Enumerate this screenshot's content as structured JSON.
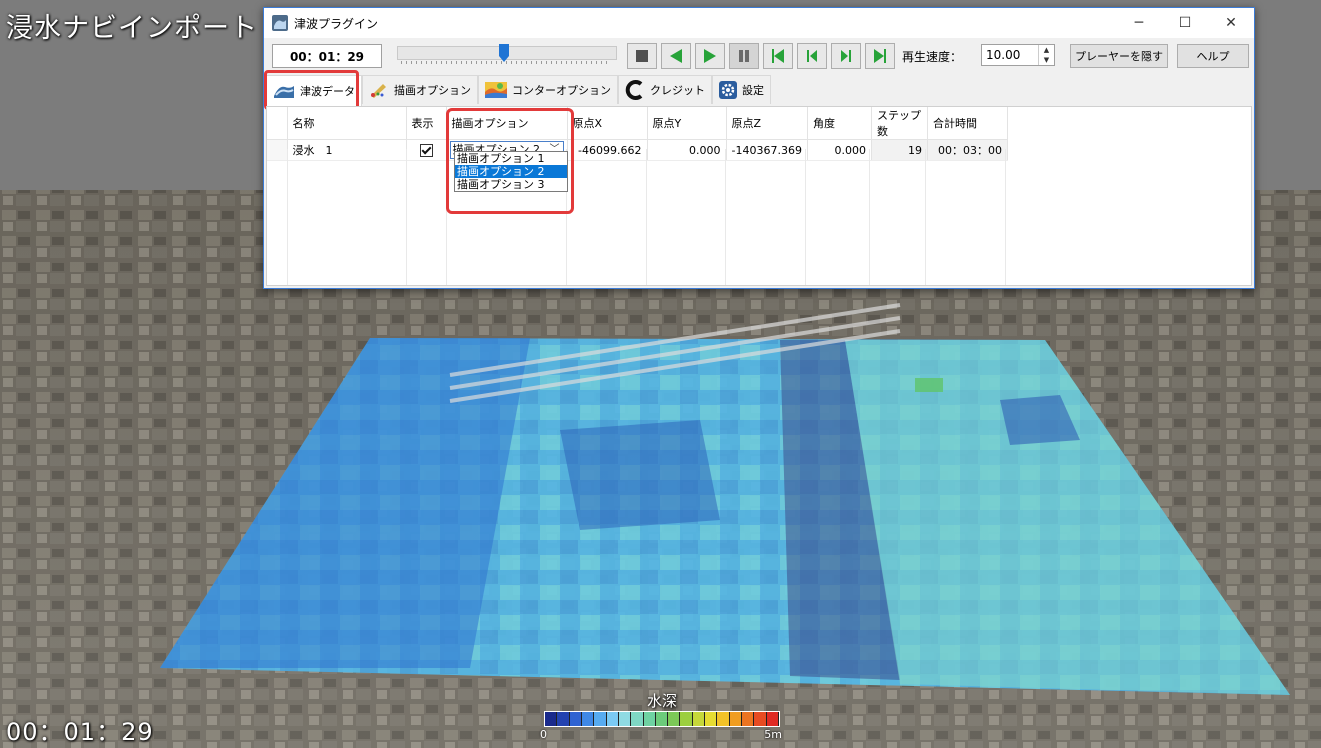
{
  "overlay": {
    "app_title": "浸水ナビインポート",
    "time": "00：01：29"
  },
  "legend": {
    "title": "水深",
    "min_label": "0",
    "max_label": "5m",
    "colors": [
      "#1a2a8c",
      "#2342b0",
      "#2f63d1",
      "#3f88e6",
      "#57abf0",
      "#7bcaf4",
      "#8fdbe3",
      "#7fd8c4",
      "#6fd2a2",
      "#6ccb7a",
      "#7cc957",
      "#9ccf3f",
      "#c6d83a",
      "#e6dc32",
      "#f2c227",
      "#f09d20",
      "#ec7420",
      "#e84b22",
      "#e02a23"
    ]
  },
  "window": {
    "title": "津波プラグイン",
    "controls": {
      "minimize": "─",
      "maximize": "☐",
      "close": "✕"
    }
  },
  "toolbar": {
    "time": "00：01：29",
    "slider_position": 0.49,
    "speed_label": "再生速度：",
    "speed_value": "10.00",
    "hide_player_label": "プレーヤーを隠す",
    "help_label": "ヘルプ"
  },
  "tabs": [
    {
      "label": "津波データ",
      "icon": "wave-icon",
      "active": true
    },
    {
      "label": "描画オプション",
      "icon": "brush-icon",
      "active": false
    },
    {
      "label": "コンターオプション",
      "icon": "contour-map-icon",
      "active": false
    },
    {
      "label": "クレジット",
      "icon": "credit-c-icon",
      "active": false
    },
    {
      "label": "設定",
      "icon": "gear-icon",
      "active": false
    }
  ],
  "grid": {
    "columns": [
      "名称",
      "表示",
      "描画オプション",
      "原点X",
      "原点Y",
      "原点Z",
      "角度",
      "ステップ数",
      "合計時間"
    ],
    "rows": [
      {
        "name": "浸水　1",
        "visible": true,
        "draw_option": "描画オプション 2",
        "origin_x": "-46099.662",
        "origin_y": "0.000",
        "origin_z": "-140367.369",
        "angle": "0.000",
        "steps": "19",
        "total_time": "00：03：00"
      }
    ],
    "dropdown_options": [
      "描画オプション 1",
      "描画オプション 2",
      "描画オプション 3"
    ],
    "dropdown_selected_index": 1
  }
}
